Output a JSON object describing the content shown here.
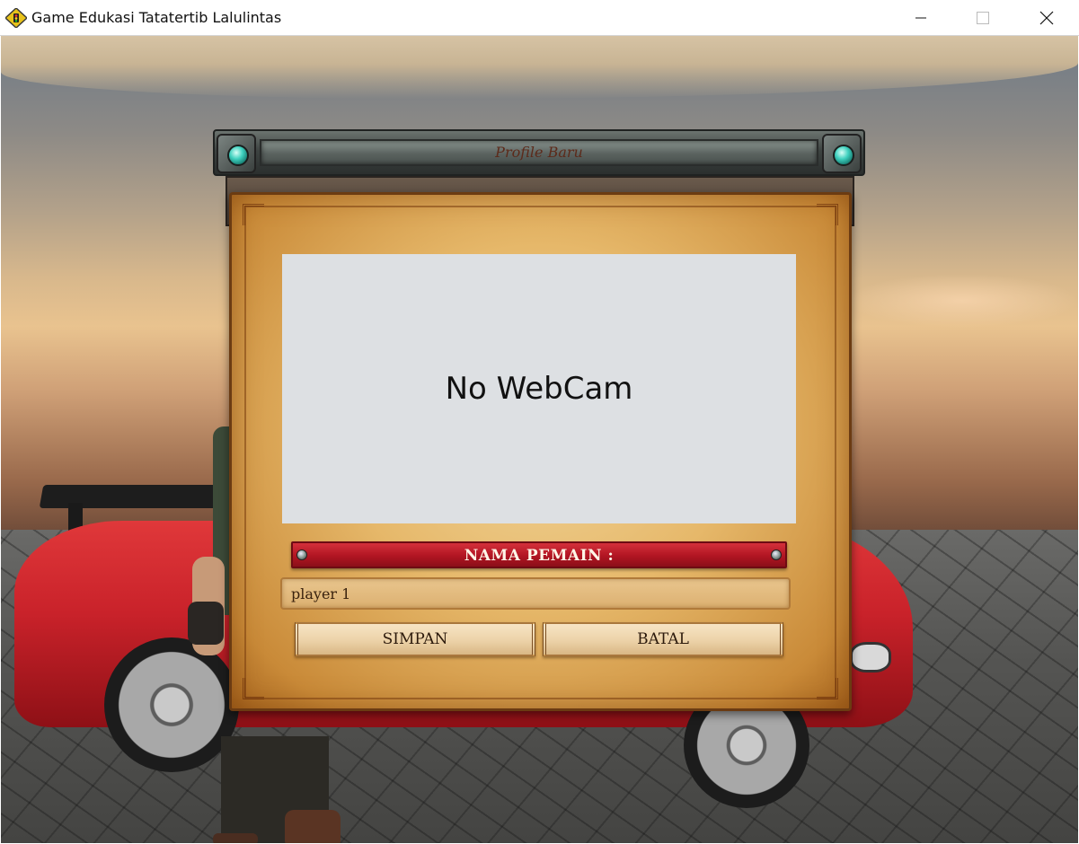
{
  "window": {
    "title": "Game Edukasi Tatatertib Lalulintas"
  },
  "dialog": {
    "title": "Profile Baru",
    "webcam_status": "No WebCam",
    "name_label": "NAMA PEMAIN :",
    "name_value": "player 1",
    "save_label": "SIMPAN",
    "cancel_label": "BATAL"
  },
  "colors": {
    "banner": "#b11522",
    "parchment": "#e6b86a",
    "gem": "#3fd1bf",
    "car": "#c9222a"
  }
}
